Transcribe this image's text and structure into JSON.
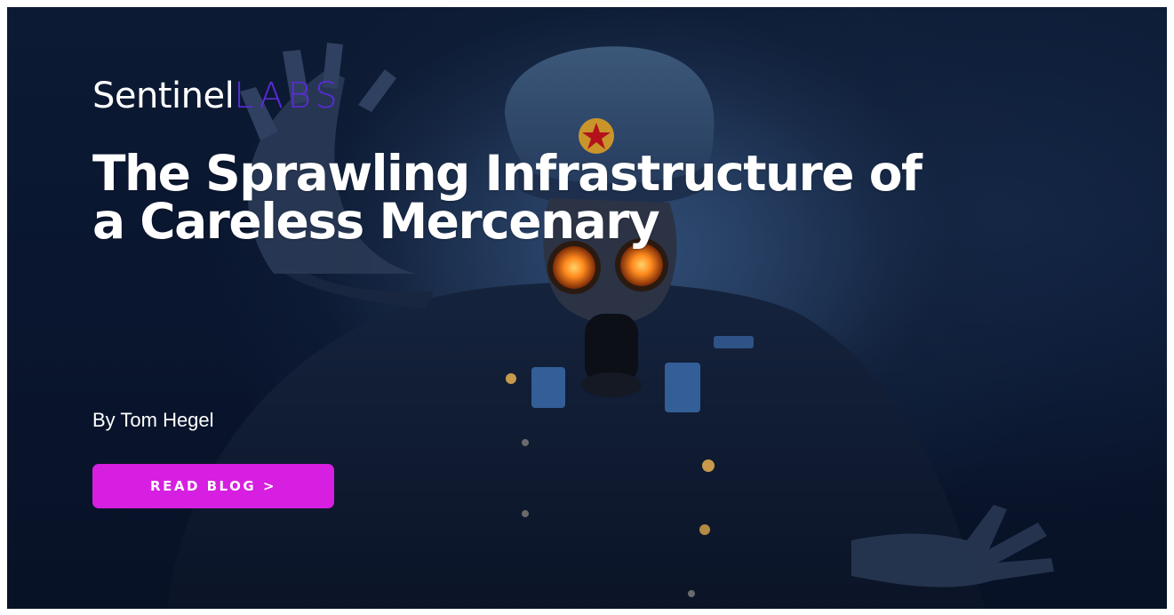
{
  "brand": {
    "logo_primary": "Sentinel",
    "logo_secondary": "LABS",
    "logo_secondary_color": "#5a2bd9"
  },
  "article": {
    "title": "The Sprawling Infrastructure of a Careless Mercenary",
    "byline": "By Tom Hegel",
    "cta_label": "READ BLOG >",
    "cta_color": "#d61fe0"
  },
  "hero_image": {
    "subject": "figure-in-gas-mask-and-fur-hat",
    "icon": "red-star-badge-icon"
  }
}
